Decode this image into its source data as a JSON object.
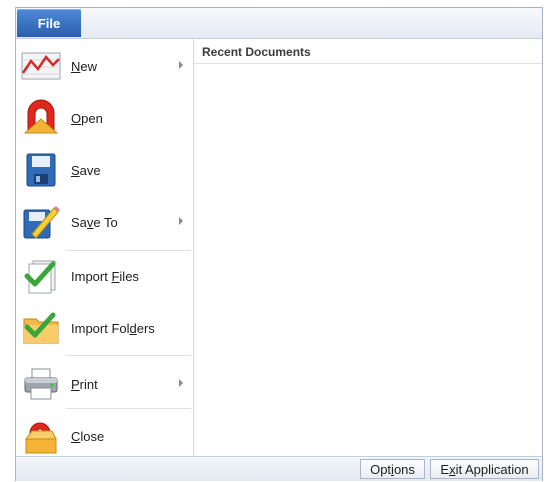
{
  "ribbon": {
    "file_tab": "File"
  },
  "menu": {
    "items": [
      {
        "label": "New",
        "mnemonic": "N",
        "icon": "chart-icon",
        "submenu": true
      },
      {
        "label": "Open",
        "mnemonic": "O",
        "icon": "open-folder-icon",
        "submenu": false
      },
      {
        "label": "Save",
        "mnemonic": "S",
        "icon": "floppy-disk-icon",
        "submenu": false
      },
      {
        "label": "Save To",
        "mnemonic": "v",
        "icon": "save-to-icon",
        "submenu": true
      },
      {
        "label": "Import Files",
        "mnemonic": "F",
        "icon": "import-files-icon",
        "submenu": false
      },
      {
        "label": "Import Folders",
        "mnemonic": "d",
        "icon": "import-folders-icon",
        "submenu": false
      },
      {
        "label": "Print",
        "mnemonic": "P",
        "icon": "printer-icon",
        "submenu": true
      },
      {
        "label": "Close",
        "mnemonic": "C",
        "icon": "close-folder-icon",
        "submenu": false
      }
    ]
  },
  "recent": {
    "title": "Recent Documents"
  },
  "footer": {
    "options_label": "Options",
    "exit_label": "Exit Application"
  },
  "colors": {
    "accent": "#2a5fad",
    "border": "#a7b4c6"
  }
}
